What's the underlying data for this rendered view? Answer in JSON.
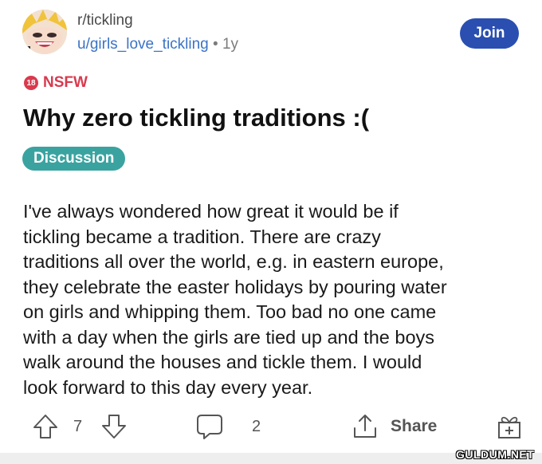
{
  "post": {
    "subreddit": "r/tickling",
    "author": "u/girls_love_tickling",
    "separator": "•",
    "age": "1y",
    "join_label": "Join",
    "nsfw_badge": "18",
    "nsfw_label": "NSFW",
    "title": "Why zero tickling traditions :(",
    "flair": "Discussion",
    "body_lines": [
      "I've always wondered how great it would be if",
      "tickling became a tradition. There are crazy",
      "traditions all over the world, e.g. in eastern europe,",
      "they celebrate the easter holidays by pouring water",
      "on girls and whipping them. Too bad no one came",
      "with a day when the girls are tied up and the boys",
      "walk around the houses and tickle them. I would",
      "look forward to this day every year."
    ]
  },
  "actions": {
    "upvote_icon": "arrow-up-icon",
    "vote_count": "7",
    "downvote_icon": "arrow-down-icon",
    "comment_icon": "comment-bubble-icon",
    "comment_count": "2",
    "share_icon": "share-icon",
    "share_label": "Share",
    "award_icon": "gift-icon"
  },
  "watermark": "GULDUM.NET",
  "colors": {
    "join_bg": "#2a4fb0",
    "nsfw": "#d93a4e",
    "flair_bg": "#3aa3a0",
    "username": "#3b73c6"
  }
}
